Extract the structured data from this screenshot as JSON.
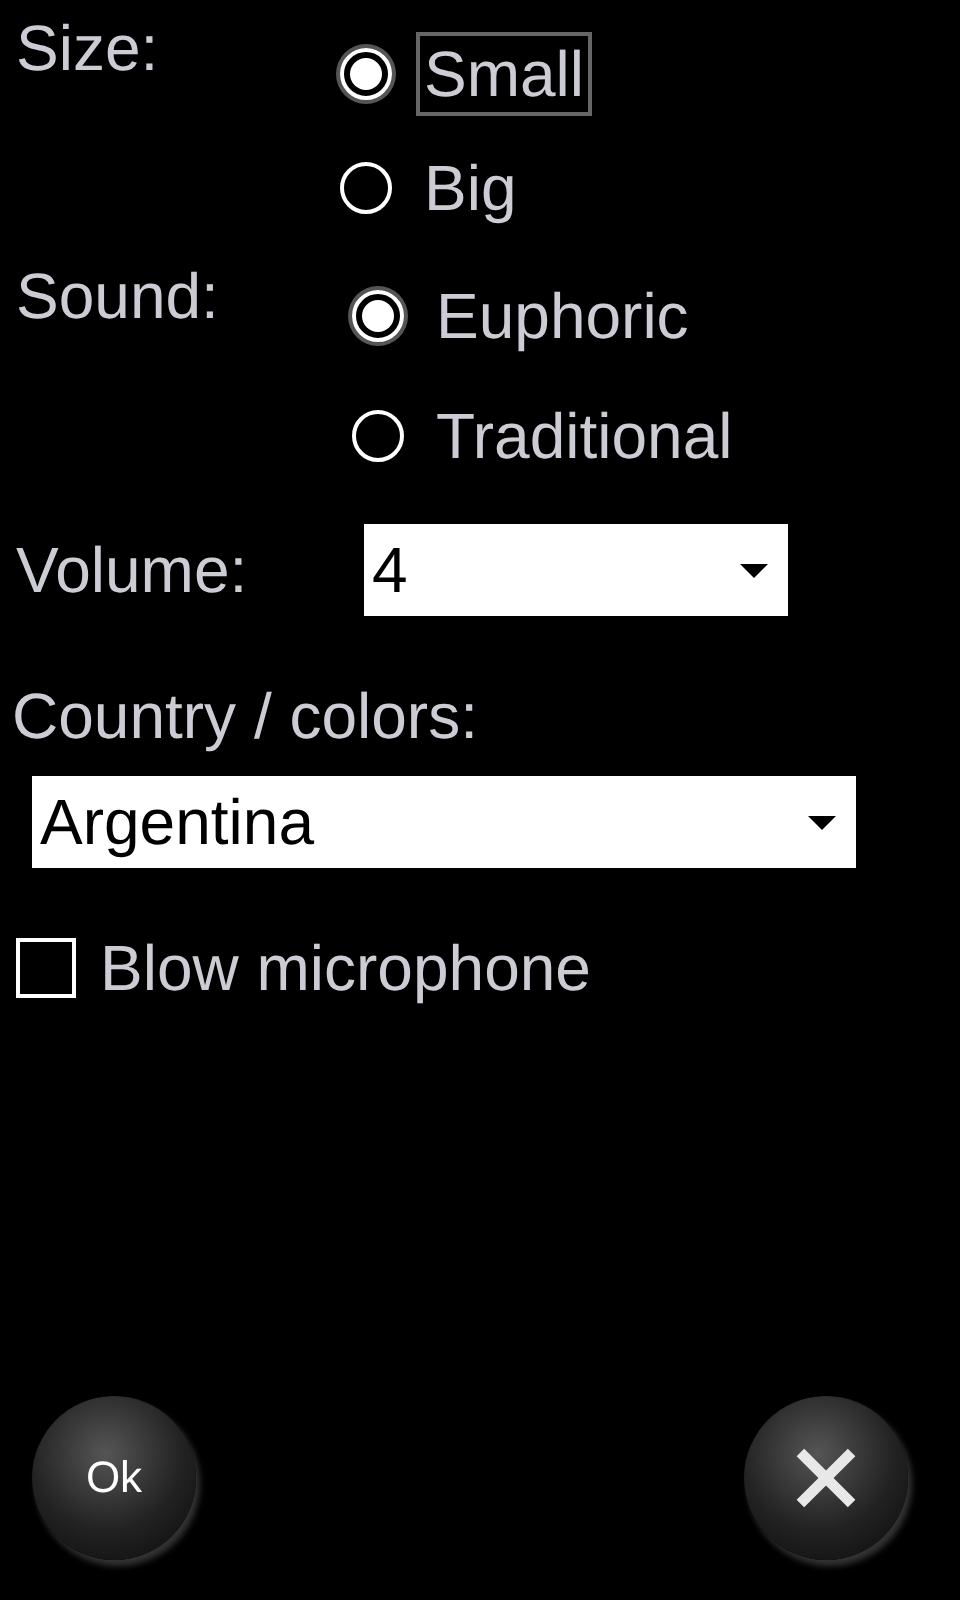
{
  "size": {
    "label": "Size:",
    "options": [
      {
        "label": "Small",
        "selected": true,
        "focused": true
      },
      {
        "label": "Big",
        "selected": false,
        "focused": false
      }
    ]
  },
  "sound": {
    "label": "Sound:",
    "options": [
      {
        "label": "Euphoric",
        "selected": true,
        "focused": false
      },
      {
        "label": "Traditional",
        "selected": false,
        "focused": false
      }
    ]
  },
  "volume": {
    "label": "Volume:",
    "value": "4"
  },
  "country": {
    "label": "Country / colors:",
    "value": "Argentina"
  },
  "blow_microphone": {
    "label": "Blow microphone",
    "checked": false
  },
  "buttons": [
    {
      "kind": "ok",
      "label": "Ok"
    },
    {
      "kind": "cancel"
    }
  ]
}
